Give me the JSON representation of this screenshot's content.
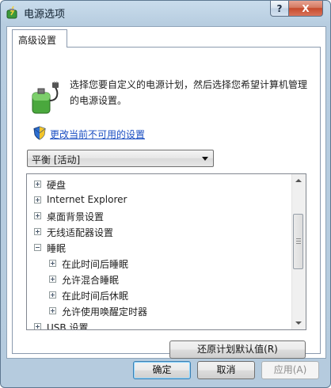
{
  "window": {
    "title": "电源选项",
    "help_label": "?",
    "close_label": "X"
  },
  "tabs": [
    {
      "label": "高级设置"
    }
  ],
  "description": "选择您要自定义的电源计划，然后选择您希望计算机管理的电源设置。",
  "change_settings_link": "更改当前不可用的设置",
  "plan_select": {
    "value": "平衡 [活动]"
  },
  "tree": [
    {
      "label": "硬盘",
      "expanded": false,
      "level": 0
    },
    {
      "label": "Internet Explorer",
      "expanded": false,
      "level": 0
    },
    {
      "label": "桌面背景设置",
      "expanded": false,
      "level": 0
    },
    {
      "label": "无线适配器设置",
      "expanded": false,
      "level": 0
    },
    {
      "label": "睡眠",
      "expanded": true,
      "level": 0
    },
    {
      "label": "在此时间后睡眠",
      "expanded": false,
      "level": 1
    },
    {
      "label": "允许混合睡眠",
      "expanded": false,
      "level": 1
    },
    {
      "label": "在此时间后休眠",
      "expanded": false,
      "level": 1
    },
    {
      "label": "允许使用唤醒定时器",
      "expanded": false,
      "level": 1
    },
    {
      "label": "USB 设置",
      "expanded": false,
      "level": 0
    }
  ],
  "restore_button": "还原计划默认值(R)",
  "buttons": {
    "ok": "确定",
    "cancel": "取消",
    "apply": "应用(A)"
  }
}
